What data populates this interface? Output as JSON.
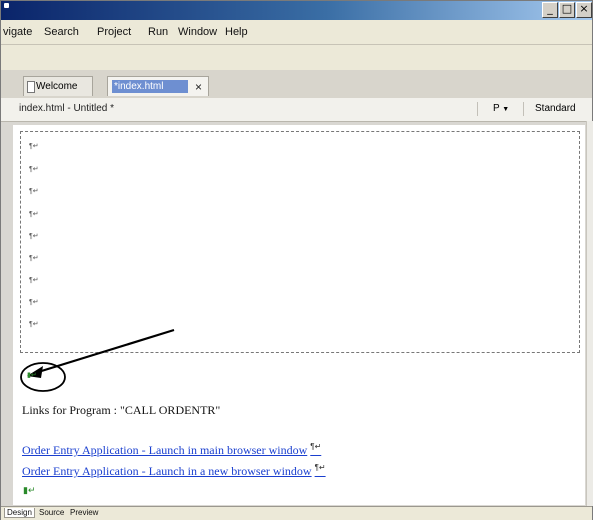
{
  "window": {
    "title_text": "",
    "controls": [
      "_",
      "□",
      "×"
    ]
  },
  "menu": {
    "items": [
      "vigate",
      "Search",
      "Project",
      "Run",
      "Window",
      "Help"
    ]
  },
  "tabs": [
    {
      "label": "Welcome",
      "active": false
    },
    {
      "label": "*index.html",
      "active": true,
      "close": "×"
    }
  ],
  "pathbar": {
    "path": "index.html - Untitled *",
    "paragraph_label": "P",
    "paragraph_arrow": "▼",
    "style_label": "Standard"
  },
  "editor": {
    "form_markers": [
      "¶↵",
      "¶↵",
      "¶↵",
      "¶↵",
      "¶↵",
      "¶↵",
      "¶↵",
      "¶↵",
      "¶↵"
    ],
    "small_marker": "▮↵",
    "links_heading": "Links for Program : \"CALL ORDENTR\"",
    "link1": "Order Entry Application - Launch in main browser window",
    "link2": "Order Entry Application - Launch in a new browser window",
    "para_mark": "¶↵",
    "cursor_mark": "▮↵"
  },
  "bottom_tabs": [
    "Design",
    "Source",
    "Preview"
  ],
  "colors": {
    "link": "#1a3fcf",
    "tab_highlight": "#6e8fd1",
    "title_gradient_start": "#0a246a"
  }
}
